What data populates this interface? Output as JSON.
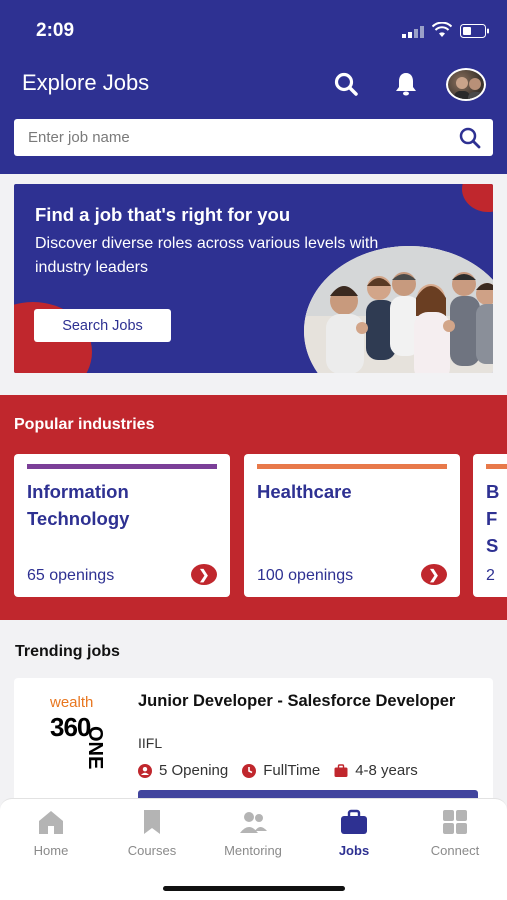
{
  "status": {
    "time": "2:09"
  },
  "header": {
    "title": "Explore Jobs"
  },
  "search": {
    "placeholder": "Enter job name"
  },
  "banner": {
    "title": "Find a job that's right for you",
    "subtitle": "Discover diverse roles across various levels with industry leaders",
    "button": "Search Jobs"
  },
  "popular": {
    "title": "Popular industries",
    "items": [
      {
        "name": "Information Technology",
        "openings": "65 openings",
        "color": "#7b3f98"
      },
      {
        "name": "Healthcare",
        "openings": "100 openings",
        "color": "#e8794a"
      },
      {
        "name": "B\nF\nS",
        "openings": "2",
        "color": "#e8794a"
      }
    ]
  },
  "trending": {
    "title": "Trending jobs",
    "jobs": [
      {
        "logo_top": "wealth",
        "logo_main": "360",
        "logo_side": "ONE",
        "title": "Junior Developer - Salesforce Developer",
        "company": "IIFL",
        "openings": "5 Opening",
        "type": "FullTime",
        "experience": "4-8 years"
      }
    ]
  },
  "tabs": [
    {
      "label": "Home",
      "icon": "home-icon"
    },
    {
      "label": "Courses",
      "icon": "bookmark-icon"
    },
    {
      "label": "Mentoring",
      "icon": "people-icon"
    },
    {
      "label": "Jobs",
      "icon": "briefcase-icon",
      "active": true
    },
    {
      "label": "Connect",
      "icon": "grid-icon"
    }
  ],
  "colors": {
    "brand": "#2e3192",
    "accent": "#c0272d"
  }
}
